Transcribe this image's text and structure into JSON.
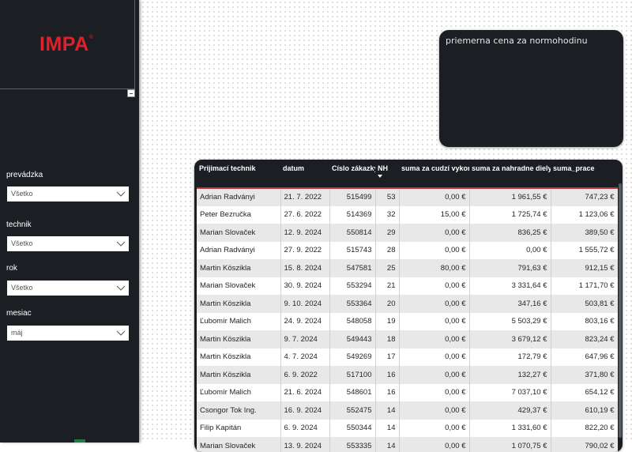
{
  "logo": {
    "text": "IMPA",
    "mark": "®"
  },
  "filters": [
    {
      "label": "prevádzka",
      "value": "Všetko"
    },
    {
      "label": "technik",
      "value": "Všetko"
    },
    {
      "label": "rok",
      "value": "Všetko"
    },
    {
      "label": "mesiac",
      "value": "máj"
    }
  ],
  "price_card": {
    "title": "priemerna cena za normohodinu"
  },
  "table": {
    "headers": [
      "Prijimací technik",
      "datum",
      "Císlo zákazky",
      "NH",
      "suma za cudzí vykon",
      "suma za nahradne diely",
      "suma_prace"
    ],
    "rows": [
      [
        "Adrian Radványi",
        "21. 7. 2022",
        "515499",
        "53",
        "0,00 €",
        "1 961,55 €",
        "747,23 €"
      ],
      [
        "Peter Bezručka",
        "27. 6. 2022",
        "514369",
        "32",
        "15,00 €",
        "1 725,74 €",
        "1 123,06 €"
      ],
      [
        "Marian Slovaček",
        "12. 9. 2024",
        "550814",
        "29",
        "0,00 €",
        "836,25 €",
        "389,50 €"
      ],
      [
        "Adrian Radványi",
        "27. 9. 2022",
        "515743",
        "28",
        "0,00 €",
        "0,00 €",
        "1 555,72 €"
      ],
      [
        "Martin Köszikla",
        "15. 8. 2024",
        "547581",
        "25",
        "80,00 €",
        "791,63 €",
        "912,15 €"
      ],
      [
        "Marian Slovaček",
        "30. 9. 2024",
        "553294",
        "21",
        "0,00 €",
        "3 331,64 €",
        "1 171,70 €"
      ],
      [
        "Martin Köszikla",
        "9. 10. 2024",
        "553364",
        "20",
        "0,00 €",
        "347,16 €",
        "503,81 €"
      ],
      [
        "Ľubomír Malich",
        "24. 9. 2024",
        "548058",
        "19",
        "0,00 €",
        "5 503,29 €",
        "803,16 €"
      ],
      [
        "Martin Köszikla",
        "9. 7. 2024",
        "549443",
        "18",
        "0,00 €",
        "3 679,12 €",
        "823,24 €"
      ],
      [
        "Martin Köszikla",
        "4. 7. 2024",
        "549269",
        "17",
        "0,00 €",
        "172,79 €",
        "647,96 €"
      ],
      [
        "Martin Köszikla",
        "6. 9. 2022",
        "517100",
        "16",
        "0,00 €",
        "132,27 €",
        "371,80 €"
      ],
      [
        "Ľubomír Malich",
        "21. 6. 2024",
        "548601",
        "16",
        "0,00 €",
        "7 037,10 €",
        "654,12 €"
      ],
      [
        "Csongor Tok Ing.",
        "16. 9. 2024",
        "552475",
        "14",
        "0,00 €",
        "429,37 €",
        "610,19 €"
      ],
      [
        "Filip Kapitán",
        "6. 9. 2024",
        "550344",
        "14",
        "0,00 €",
        "1 331,60 €",
        "822,20 €"
      ],
      [
        "Marian Slovaček",
        "13. 9. 2024",
        "553335",
        "14",
        "0,00 €",
        "1 070,75 €",
        "790,02 €"
      ]
    ]
  },
  "colors": {
    "sidebar": "#1b1f24",
    "brand": "#e3202a",
    "header_underline": "#c0323a"
  }
}
